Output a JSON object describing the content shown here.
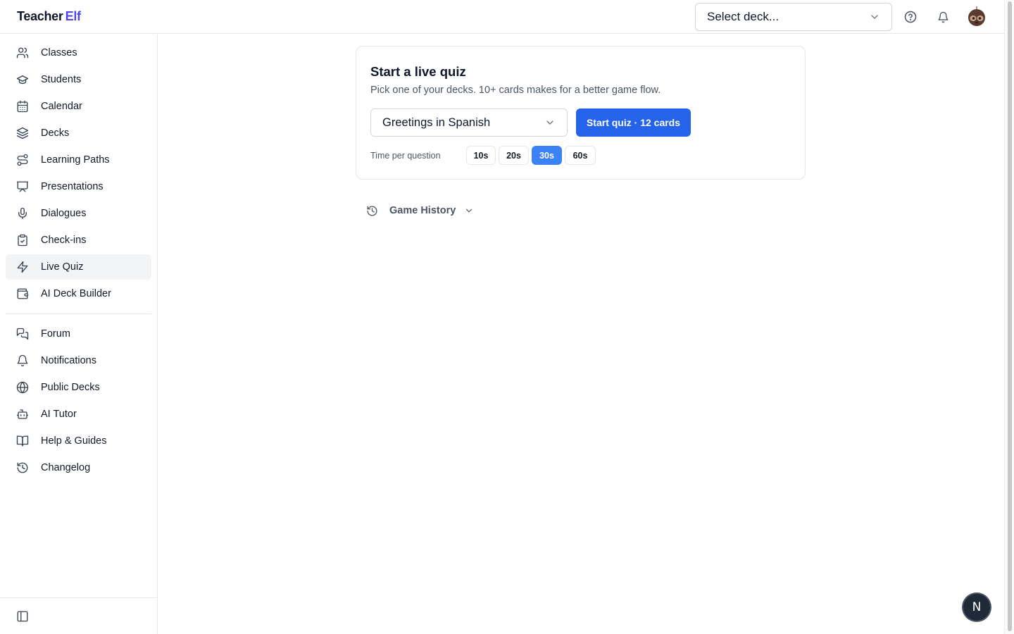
{
  "header": {
    "logo_part1": "Teacher",
    "logo_part2": "Elf",
    "deck_select_label": "Select deck...",
    "icons": [
      "help-circle-icon",
      "bell-icon",
      "avatar"
    ]
  },
  "sidebar": {
    "items": [
      {
        "label": "Classes",
        "icon": "users-icon"
      },
      {
        "label": "Students",
        "icon": "graduation-cap-icon"
      },
      {
        "label": "Calendar",
        "icon": "calendar-icon"
      },
      {
        "label": "Decks",
        "icon": "layers-icon"
      },
      {
        "label": "Learning Paths",
        "icon": "route-icon"
      },
      {
        "label": "Presentations",
        "icon": "presentation-icon"
      },
      {
        "label": "Dialogues",
        "icon": "mic-icon"
      },
      {
        "label": "Check-ins",
        "icon": "clipboard-check-icon"
      },
      {
        "label": "Live Quiz",
        "icon": "zap-icon",
        "active": true
      },
      {
        "label": "AI Deck Builder",
        "icon": "wallet-icon"
      }
    ],
    "secondary_items": [
      {
        "label": "Forum",
        "icon": "messages-icon"
      },
      {
        "label": "Notifications",
        "icon": "bell-icon"
      },
      {
        "label": "Public Decks",
        "icon": "globe-icon"
      },
      {
        "label": "AI Tutor",
        "icon": "bot-icon"
      },
      {
        "label": "Help & Guides",
        "icon": "book-open-icon"
      },
      {
        "label": "Changelog",
        "icon": "history-icon"
      }
    ]
  },
  "quiz": {
    "title": "Start a live quiz",
    "subtitle": "Pick one of your decks. 10+ cards makes for a better game flow.",
    "selected_deck": "Greetings in Spanish",
    "start_button": "Start quiz · 12 cards",
    "time_label": "Time per question",
    "time_options": [
      "10s",
      "20s",
      "30s",
      "60s"
    ],
    "selected_time": "30s"
  },
  "history": {
    "label": "Game History"
  },
  "badge": {
    "letter": "N"
  },
  "colors": {
    "accent": "#2563eb",
    "selected_time": "#3b82f6",
    "logo_accent": "#4f46e5"
  }
}
